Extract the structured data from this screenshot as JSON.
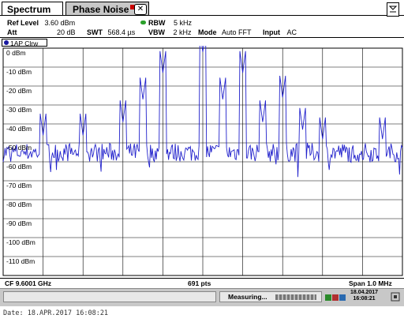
{
  "tabs": [
    {
      "label": "Spectrum"
    },
    {
      "label": "Phase Noise"
    }
  ],
  "header": {
    "ref_level_label": "Ref Level",
    "ref_level_value": "3.60 dBm",
    "att_label": "Att",
    "att_value": "20 dB",
    "swt_label": "SWT",
    "swt_value": "568.4 µs",
    "rbw_label": "RBW",
    "rbw_value": "5 kHz",
    "vbw_label": "VBW",
    "vbw_value": "2 kHz",
    "mode_label": "Mode",
    "mode_value": "Auto FFT",
    "input_label": "Input",
    "input_value": "AC"
  },
  "trace_label": "1AP Clrw",
  "y_ticks": [
    "0 dBm",
    "-10 dBm",
    "-20 dBm",
    "-30 dBm",
    "-40 dBm",
    "-50 dBm",
    "-60 dBm",
    "-70 dBm",
    "-80 dBm",
    "-90 dBm",
    "-100 dBm",
    "-110 dBm"
  ],
  "footer": {
    "cf": "CF 9.6001 GHz",
    "pts": "691 pts",
    "span": "Span 1.0 MHz"
  },
  "status": {
    "measuring": "Measuring...",
    "date": "18.04.2017",
    "time": "16:08:21"
  },
  "bottom_date": "Date: 18.APR.2017  16:08:21",
  "colors": {
    "trace": "#2222cc",
    "grid": "#000000",
    "tab_inactive": "#c8c8c8",
    "status_bar": "#c8c8c8"
  },
  "chart_data": {
    "type": "line",
    "y_axis_range_dBm": [
      -120,
      0
    ],
    "x_axis": "frequency, CF 9.6001 GHz, Span 1.0 MHz",
    "noise_floor_dBm": -55,
    "peaks": [
      {
        "offset_div": -1.0,
        "level_dBm": -13
      },
      {
        "offset_div": 0.0,
        "level_dBm": -2
      },
      {
        "offset_div": 1.0,
        "level_dBm": -13
      },
      {
        "offset_div": -1.5,
        "level_dBm": -27
      },
      {
        "offset_div": 0.5,
        "level_dBm": -27
      },
      {
        "offset_div": 2.0,
        "level_dBm": -26
      },
      {
        "offset_div": -2.0,
        "level_dBm": -39
      },
      {
        "offset_div": 1.5,
        "level_dBm": -39
      },
      {
        "offset_div": -3.0,
        "level_dBm": -46
      },
      {
        "offset_div": 2.5,
        "level_dBm": -43
      },
      {
        "offset_div": -4.0,
        "level_dBm": -46
      },
      {
        "offset_div": 3.0,
        "level_dBm": -48
      },
      {
        "offset_div": 4.5,
        "level_dBm": -48
      }
    ]
  }
}
